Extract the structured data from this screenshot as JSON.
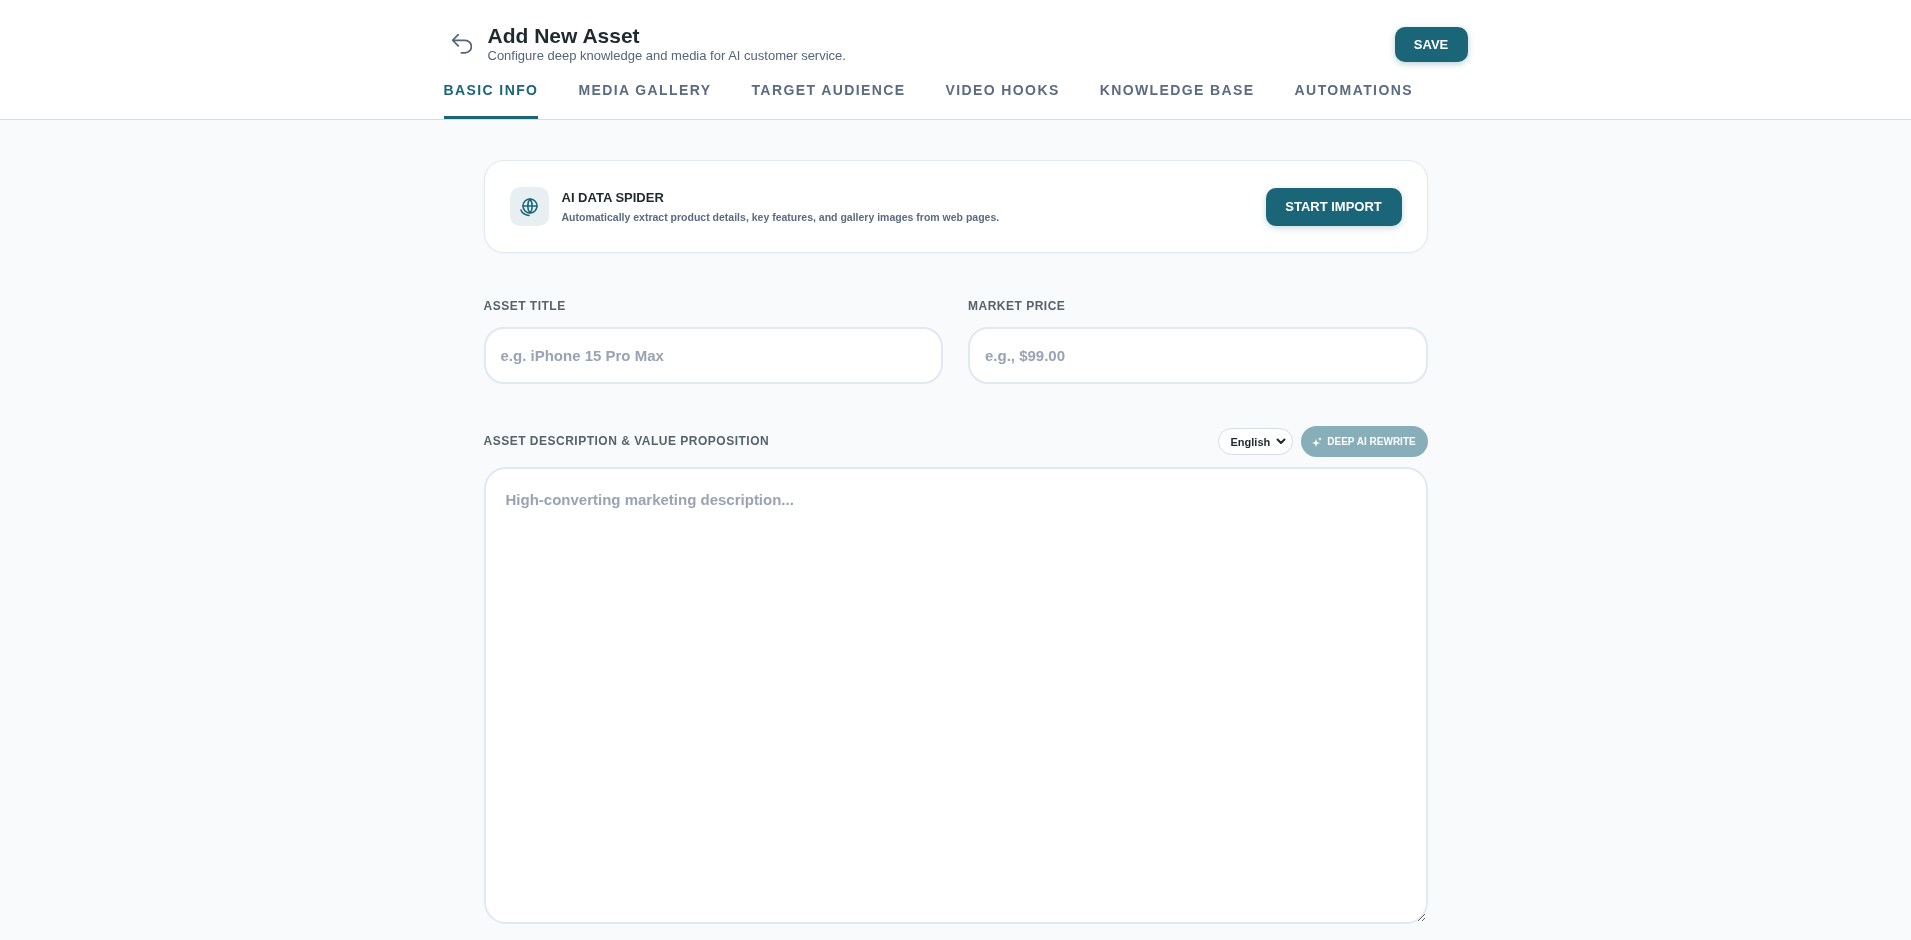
{
  "header": {
    "title": "Add New Asset",
    "subtitle": "Configure deep knowledge and media for AI customer service.",
    "save_button": "SAVE"
  },
  "tabs": [
    {
      "label": "BASIC INFO",
      "selected": true
    },
    {
      "label": "MEDIA GALLERY",
      "selected": false
    },
    {
      "label": "TARGET AUDIENCE",
      "selected": false
    },
    {
      "label": "VIDEO HOOKS",
      "selected": false
    },
    {
      "label": "KNOWLEDGE BASE",
      "selected": false
    },
    {
      "label": "AUTOMATIONS",
      "selected": false
    }
  ],
  "import_card": {
    "title": "AI DATA SPIDER",
    "description": "Automatically extract product details, key features, and gallery images from web pages.",
    "button": "START IMPORT"
  },
  "fields": [
    {
      "label": "ASSET TITLE",
      "placeholder": "e.g. iPhone 15 Pro Max"
    },
    {
      "label": "MARKET PRICE",
      "placeholder": "e.g., $99.00"
    }
  ],
  "description": {
    "label": "ASSET DESCRIPTION & VALUE PROPOSITION",
    "language": "English",
    "rewrite_button": {
      "label": "DEEP AI REWRITE",
      "disabled": true
    },
    "placeholder": "High-converting marketing description..."
  }
}
